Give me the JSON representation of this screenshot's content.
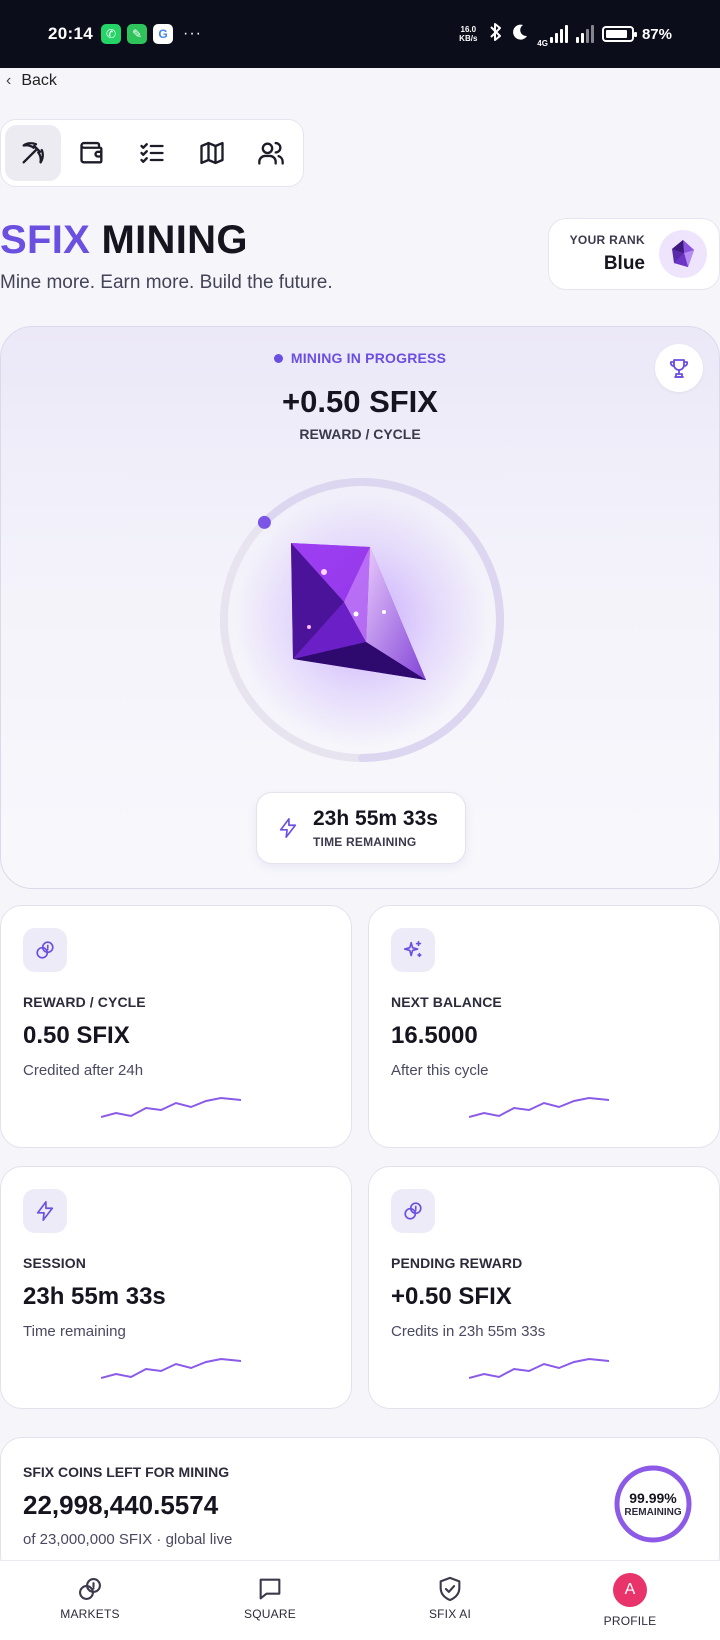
{
  "status_bar": {
    "time": "20:14",
    "speed": "16.0 KB/s",
    "network": "4G",
    "battery": "87%",
    "battery_level": 0.87,
    "more": "···",
    "icons": [
      "whatsapp-icon",
      "app-icon",
      "google-icon",
      "bluetooth-icon",
      "moon-icon",
      "signal-icon",
      "signal-icon",
      "battery-icon"
    ]
  },
  "nav": {
    "back_label": "Back"
  },
  "toolbar": {
    "tools": [
      {
        "name": "pickaxe",
        "icon": "pickaxe-icon",
        "active": true
      },
      {
        "name": "wallet",
        "icon": "wallet-icon",
        "active": false
      },
      {
        "name": "tasks",
        "icon": "checklist-icon",
        "active": false
      },
      {
        "name": "map",
        "icon": "map-icon",
        "active": false
      },
      {
        "name": "users",
        "icon": "users-icon",
        "active": false
      }
    ]
  },
  "header": {
    "title_accent": "SFIX",
    "title_rest": " MINING",
    "subtitle": "Mine more. Earn more. Build the future."
  },
  "rank": {
    "label": "YOUR RANK",
    "value": "Blue"
  },
  "hero": {
    "status": "MINING IN PROGRESS",
    "reward": "+0.50 SFIX",
    "reward_label": "REWARD / CYCLE",
    "progress": 0.2,
    "timer": "23h 55m 33s",
    "timer_label": "TIME REMAINING"
  },
  "stats": [
    {
      "icon": "coins-icon",
      "label": "REWARD / CYCLE",
      "value": "0.50 SFIX",
      "sub": "Credited after 24h"
    },
    {
      "icon": "sparkles-icon",
      "label": "NEXT BALANCE",
      "value": "16.5000",
      "sub": "After this cycle"
    },
    {
      "icon": "lightning-icon",
      "label": "SESSION",
      "value": "23h 55m 33s",
      "sub": "Time remaining"
    },
    {
      "icon": "coins-icon",
      "label": "PENDING REWARD",
      "value": "+0.50 SFIX",
      "sub": "Credits in 23h 55m 33s"
    }
  ],
  "coins_left": {
    "label": "SFIX COINS LEFT FOR MINING",
    "value": "22,998,440.5574",
    "sub": "of 23,000,000 SFIX · global live",
    "percent": "99.99%",
    "percent_label": "REMAINING",
    "fraction": 0.9999
  },
  "bottom_nav": [
    {
      "icon": "coins-icon",
      "label": "MARKETS"
    },
    {
      "icon": "chat-icon",
      "label": "SQUARE"
    },
    {
      "icon": "shield-check-icon",
      "label": "SFIX AI"
    },
    {
      "icon": "avatar",
      "label": "PROFILE",
      "avatar_letter": "A"
    }
  ],
  "colors": {
    "accent": "#6b4fe0",
    "avatar": "#e8336b",
    "status_bar": "#0b0d1a"
  }
}
